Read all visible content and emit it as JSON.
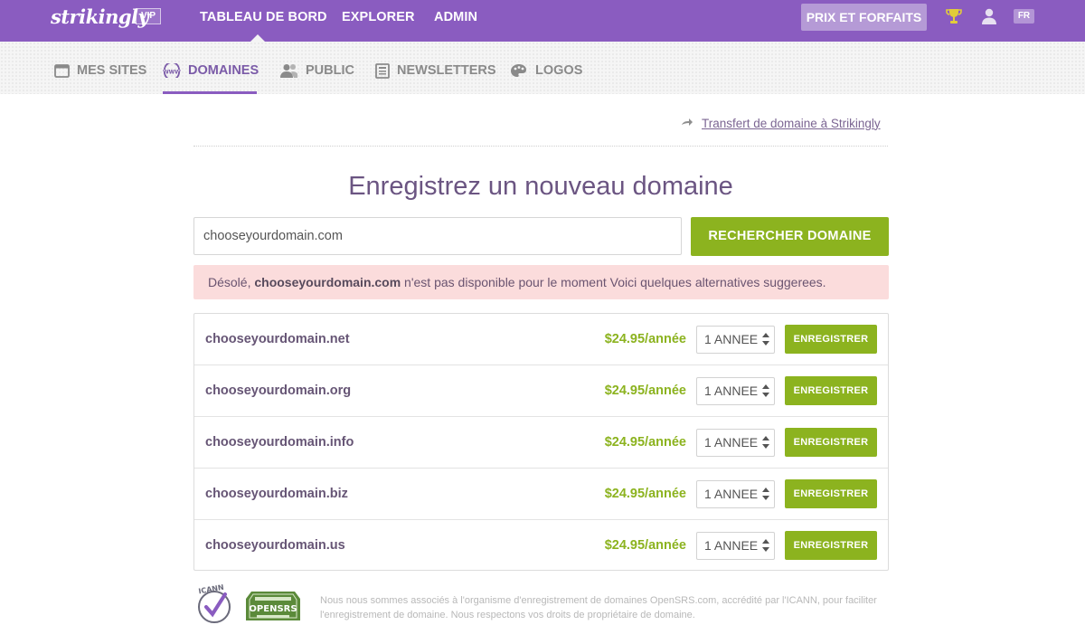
{
  "topbar": {
    "logo": "strikingly",
    "vip": "VIP",
    "nav": [
      "TABLEAU DE BORD",
      "EXPLORER",
      "ADMIN"
    ],
    "pricing": "PRIX ET FORFAITS",
    "lang": "FR"
  },
  "subnav": {
    "items": [
      {
        "label": "MES SITES",
        "icon": "calendar-icon"
      },
      {
        "label": "DOMAINES",
        "icon": "www-globe-icon"
      },
      {
        "label": "PUBLIC",
        "icon": "users-icon"
      },
      {
        "label": "NEWSLETTERS",
        "icon": "newsletter-icon"
      },
      {
        "label": "LOGOS",
        "icon": "palette-icon"
      }
    ],
    "active": "DOMAINES"
  },
  "transfer_link": "Transfert de domaine à Strikingly",
  "heading": "Enregistrez un nouveau domaine",
  "search": {
    "value": "chooseyourdomain.com",
    "button": "RECHERCHER DOMAINE"
  },
  "alert": {
    "prefix": "Désolé, ",
    "domain": "chooseyourdomain.com",
    "suffix": " n'est pas disponible pour le moment Voici quelques alternatives suggerees."
  },
  "results": [
    {
      "domain": "chooseyourdomain.net",
      "price": "$24.95/année",
      "period": "1 ANNEE",
      "button": "ENREGISTRER"
    },
    {
      "domain": "chooseyourdomain.org",
      "price": "$24.95/année",
      "period": "1 ANNEE",
      "button": "ENREGISTRER"
    },
    {
      "domain": "chooseyourdomain.info",
      "price": "$24.95/année",
      "period": "1 ANNEE",
      "button": "ENREGISTRER"
    },
    {
      "domain": "chooseyourdomain.biz",
      "price": "$24.95/année",
      "period": "1 ANNEE",
      "button": "ENREGISTRER"
    },
    {
      "domain": "chooseyourdomain.us",
      "price": "$24.95/année",
      "period": "1 ANNEE",
      "button": "ENREGISTRER"
    }
  ],
  "footer": {
    "icann_logo": "ICANN",
    "opensrs_logo": "OPENSRS",
    "note": "Nous nous sommes associés à l'organisme d'enregistrement de domaines OpenSRS.com, accrédité par l'ICANN, pour faciliter l'enregistrement de domaine. Nous respectons vos droits de propriétaire de domaine."
  },
  "colors": {
    "brand_purple": "#8a5cc0",
    "accent_green": "#8cb31f",
    "alert_bg": "#fbdcdc"
  }
}
